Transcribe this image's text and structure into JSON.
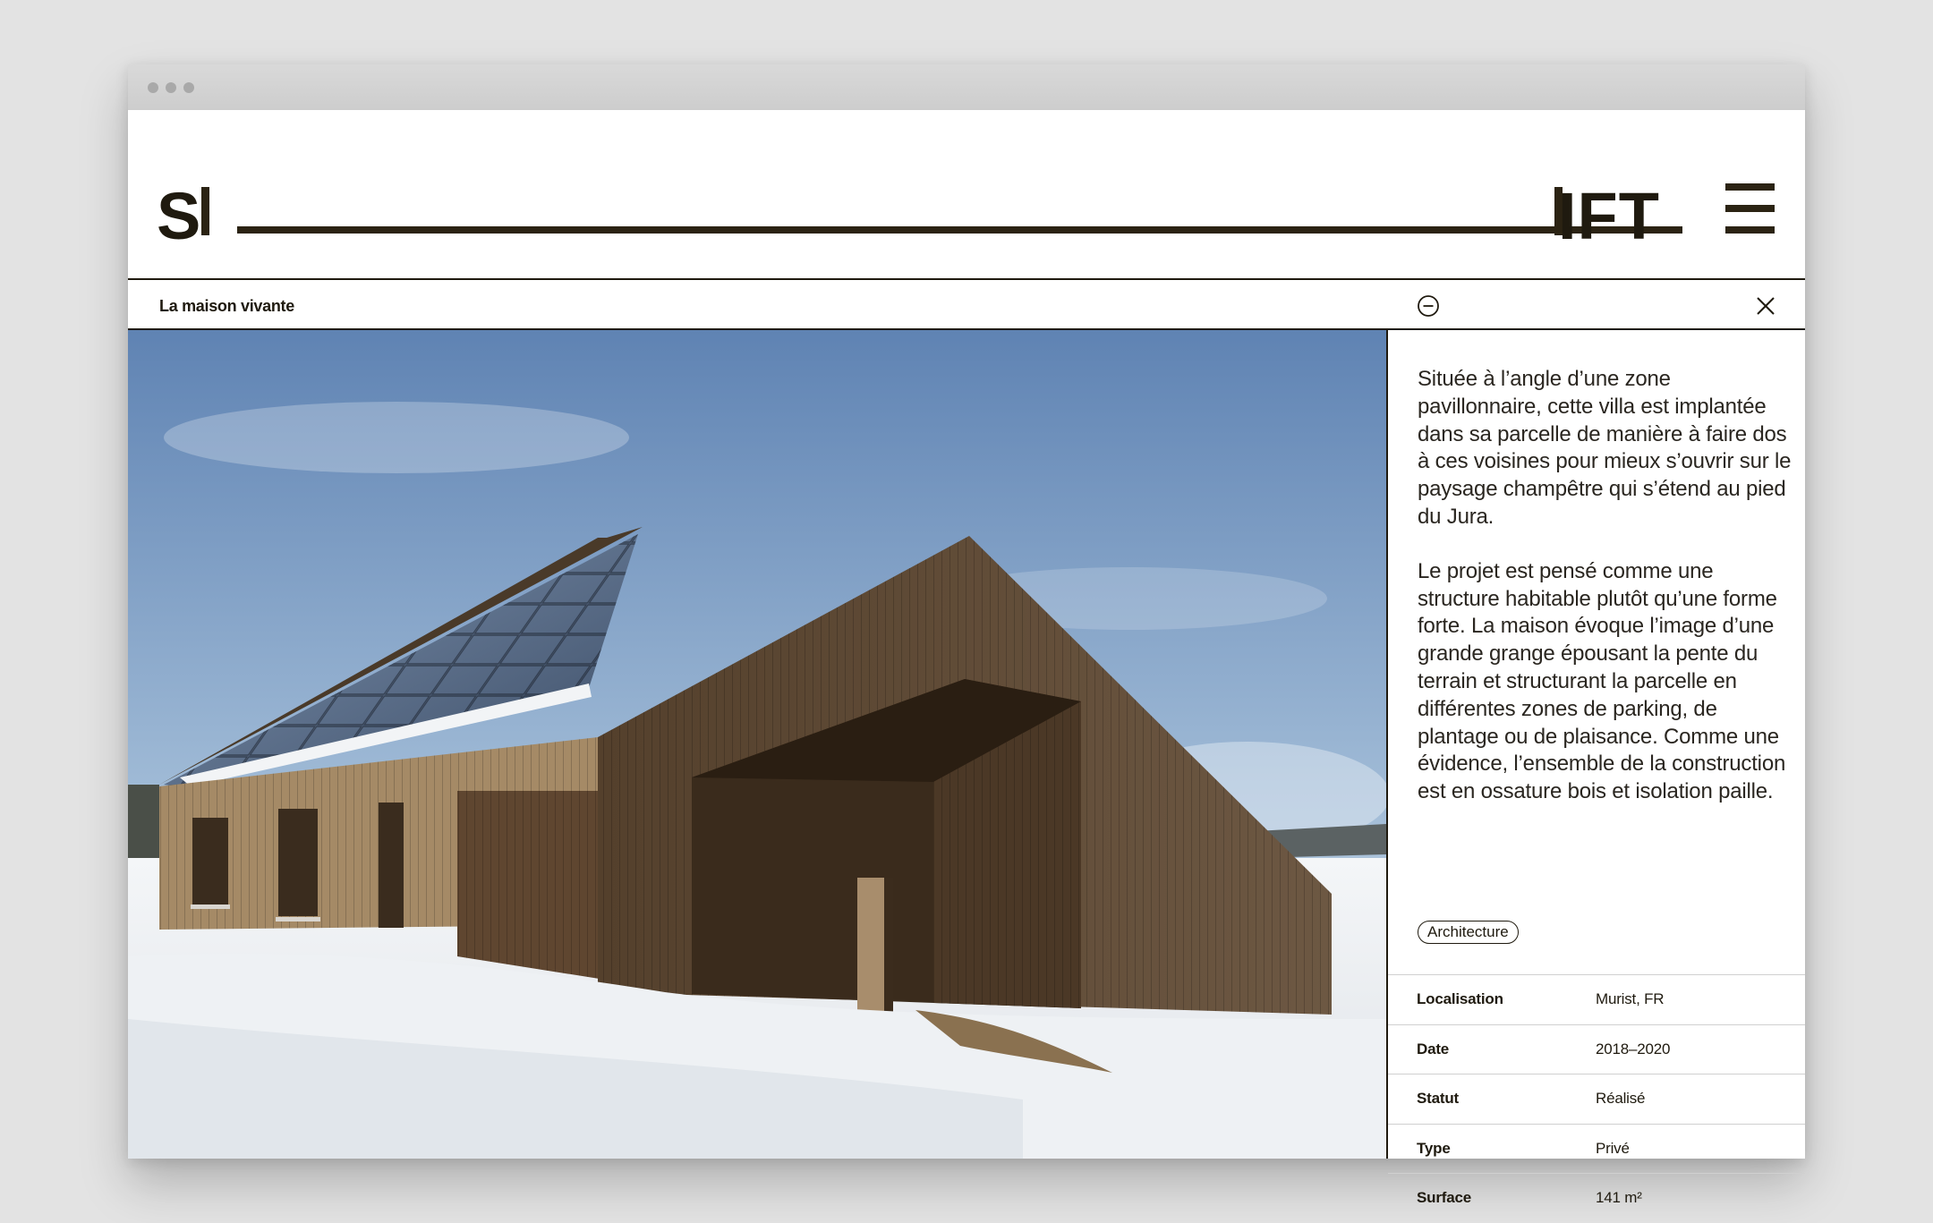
{
  "header": {
    "logo_left": "SH",
    "logo_right": "IFT",
    "menu_icon": "hamburger-menu-icon"
  },
  "project": {
    "title": "La maison vivante",
    "collapse_icon": "minus-circle-icon",
    "close_icon": "close-icon",
    "photo_icon": "photo-wooden-barn-house-in-snow"
  },
  "description": {
    "paragraphs": [
      "Située à l’angle d’une zone pavillonnaire, cette villa est implantée dans sa parcelle de manière à faire dos à ces voisines pour mieux s’ouvrir sur le paysage champêtre qui s’étend au pied du Jura.",
      "Le projet est pensé comme une structure habitable plutôt qu’une forme forte. La maison évoque l’image d’une grande grange épousant la pente du terrain et structurant la parcelle en différentes zones de parking, de plantage ou de plaisance. Comme une évidence, l’ensemble de la construction est en ossature bois et isolation paille."
    ],
    "tag": "Architecture"
  },
  "specs": [
    {
      "label": "Localisation",
      "value": "Murist, FR"
    },
    {
      "label": "Date",
      "value": "2018–2020"
    },
    {
      "label": "Statut",
      "value": "Réalisé"
    },
    {
      "label": "Type",
      "value": "Privé"
    },
    {
      "label": "Surface",
      "value": "141 m²"
    }
  ],
  "colors": {
    "ink": "#1f1a0f",
    "background": "#e3e3e3",
    "window": "#ffffff"
  }
}
